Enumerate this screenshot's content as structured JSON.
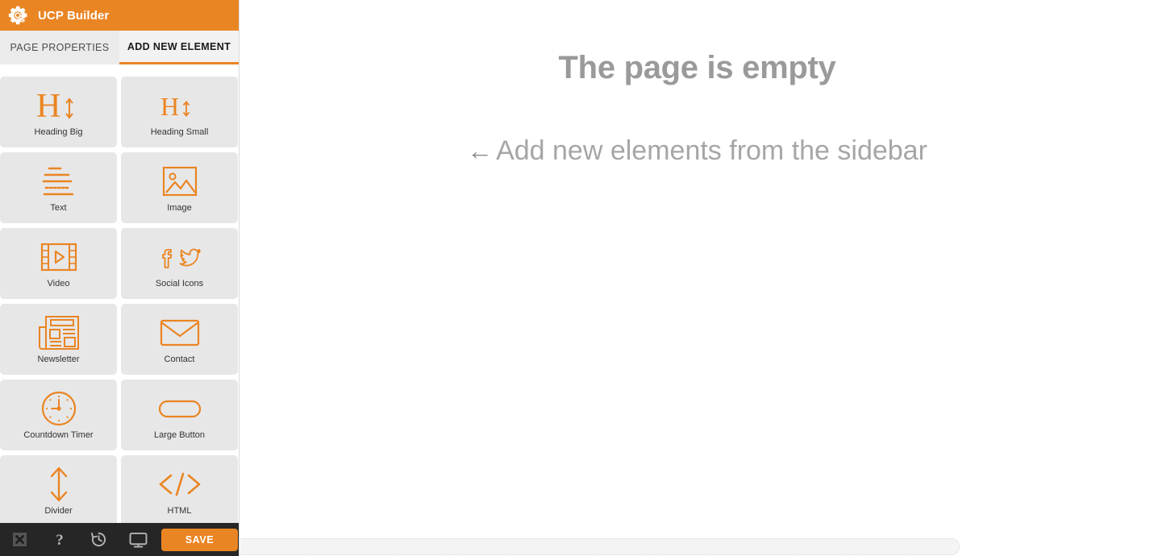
{
  "app": {
    "title": "UCP Builder",
    "logo_icon": "gear-wrench-icon",
    "accent_color": "#ea8523",
    "toolbar_bg": "#262626",
    "tile_bg": "#e7e7e7"
  },
  "tabs": [
    {
      "label": "PAGE PROPERTIES",
      "name": "tab-page-properties",
      "active": false
    },
    {
      "label": "ADD NEW ELEMENT",
      "name": "tab-add-new-element",
      "active": true
    }
  ],
  "elements": [
    {
      "label": "Heading Big",
      "icon": "heading-big-icon"
    },
    {
      "label": "Heading Small",
      "icon": "heading-small-icon"
    },
    {
      "label": "Text",
      "icon": "text-lines-icon"
    },
    {
      "label": "Image",
      "icon": "image-icon"
    },
    {
      "label": "Video",
      "icon": "video-film-icon"
    },
    {
      "label": "Social Icons",
      "icon": "social-icons-icon"
    },
    {
      "label": "Newsletter",
      "icon": "newspaper-icon"
    },
    {
      "label": "Contact",
      "icon": "envelope-icon"
    },
    {
      "label": "Countdown Timer",
      "icon": "clock-icon"
    },
    {
      "label": "Large Button",
      "icon": "pill-button-icon"
    },
    {
      "label": "Divider",
      "icon": "up-down-arrow-icon"
    },
    {
      "label": "HTML",
      "icon": "code-brackets-icon"
    }
  ],
  "collapse_handle": {
    "icon": "chevron-left-icon",
    "name": "sidebar-collapse-handle"
  },
  "bottom_toolbar": {
    "buttons": [
      {
        "name": "close-button",
        "icon": "close-box-icon",
        "label": ""
      },
      {
        "name": "help-button",
        "icon": "question-mark-icon",
        "label": "?"
      },
      {
        "name": "history-button",
        "icon": "history-clock-icon",
        "label": ""
      },
      {
        "name": "preview-button",
        "icon": "monitor-icon",
        "label": ""
      }
    ],
    "save_label": "SAVE"
  },
  "canvas": {
    "empty_title": "The page is empty",
    "empty_hint_arrow": "←",
    "empty_hint": "Add new elements from the sidebar"
  }
}
